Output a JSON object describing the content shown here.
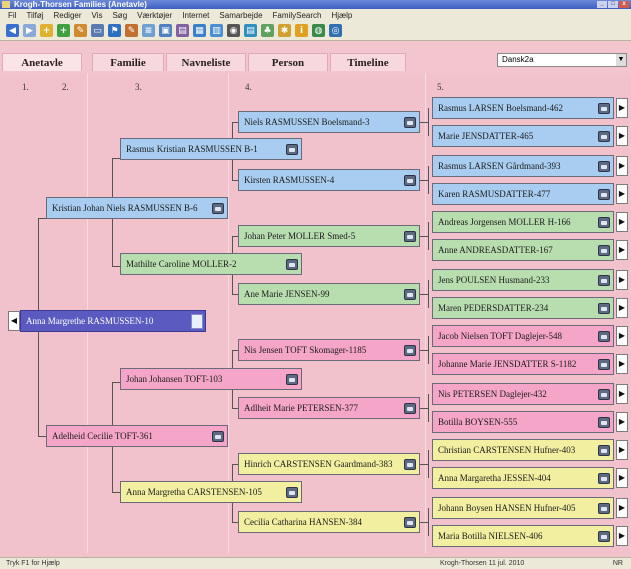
{
  "titlebar": {
    "title": "Krogh-Thorsen Families (Anetavle)"
  },
  "menu": [
    "Fil",
    "Tilføj",
    "Rediger",
    "Vis",
    "Søg",
    "Værktøjer",
    "Internet",
    "Samarbejde",
    "FamilySearch",
    "Hjælp"
  ],
  "tabs": [
    "Anetavle",
    "Familie",
    "Navneliste",
    "Person",
    "Timeline"
  ],
  "language": "Dansk2a",
  "columns": [
    "1.",
    "2.",
    "3.",
    "4.",
    "5."
  ],
  "people": {
    "root": "Anna Margrethe RASMUSSEN-10",
    "father": "Kristian Johan Niels RASMUSSEN B-6",
    "mother": "Adelheid Cecilie TOFT-361",
    "ff": "Rasmus Kristian RASMUSSEN B-1",
    "fm": "Mathilte Caroline MOLLER-2",
    "mf": "Johan Johansen TOFT-103",
    "mm": "Anna Margretha CARSTENSEN-105",
    "fff": "Niels RASMUSSEN Boelsmand-3",
    "ffm": "Kirsten RASMUSSEN-4",
    "fmf": "Johan Peter MOLLER Smed-5",
    "fmm": "Ane Marie JENSEN-99",
    "mff": "Nis Jensen TOFT Skomager-1185",
    "mfm": "Adlheit Marie PETERSEN-377",
    "mmf": "Hinrich CARSTENSEN Gaardmand-383",
    "mmm": "Cecilia Catharina HANSEN-384",
    "g1": "Rasmus LARSEN Boelsmand-462",
    "g2": "Marie JENSDATTER-465",
    "g3": "Rasmus LARSEN Gårdmand-393",
    "g4": "Karen RASMUSDATTER-477",
    "g5": "Andreas Jorgensen MOLLER H-166",
    "g6": "Anne ANDREASDATTER-167",
    "g7": "Jens POULSEN Husmand-233",
    "g8": "Maren PEDERSDATTER-234",
    "g9": "Jacob Nielsen TOFT Daglejer-548",
    "g10": "Johanne Marie JENSDATTER S-1182",
    "g11": "Nis PETERSEN Daglejer-432",
    "g12": "Botilla BOYSEN-555",
    "g13": "Christian CARSTENSEN Hufner-403",
    "g14": "Anna Margaretha JESSEN-404",
    "g15": "Johann Boysen HANSEN Hufner-405",
    "g16": "Maria Botilla NIELSEN-406"
  },
  "status": {
    "left": "Tryk F1 for Hjælp",
    "middle": "Krogh-Thorsen 11 jul. 2010",
    "right": "NR"
  },
  "colors": {
    "blue": "#a9cdf0",
    "green": "#b8deb0",
    "pink": "#f5a6c8",
    "yellow": "#f2f0a0",
    "root": "#5a5ac0",
    "background": "#f2c2cc"
  }
}
